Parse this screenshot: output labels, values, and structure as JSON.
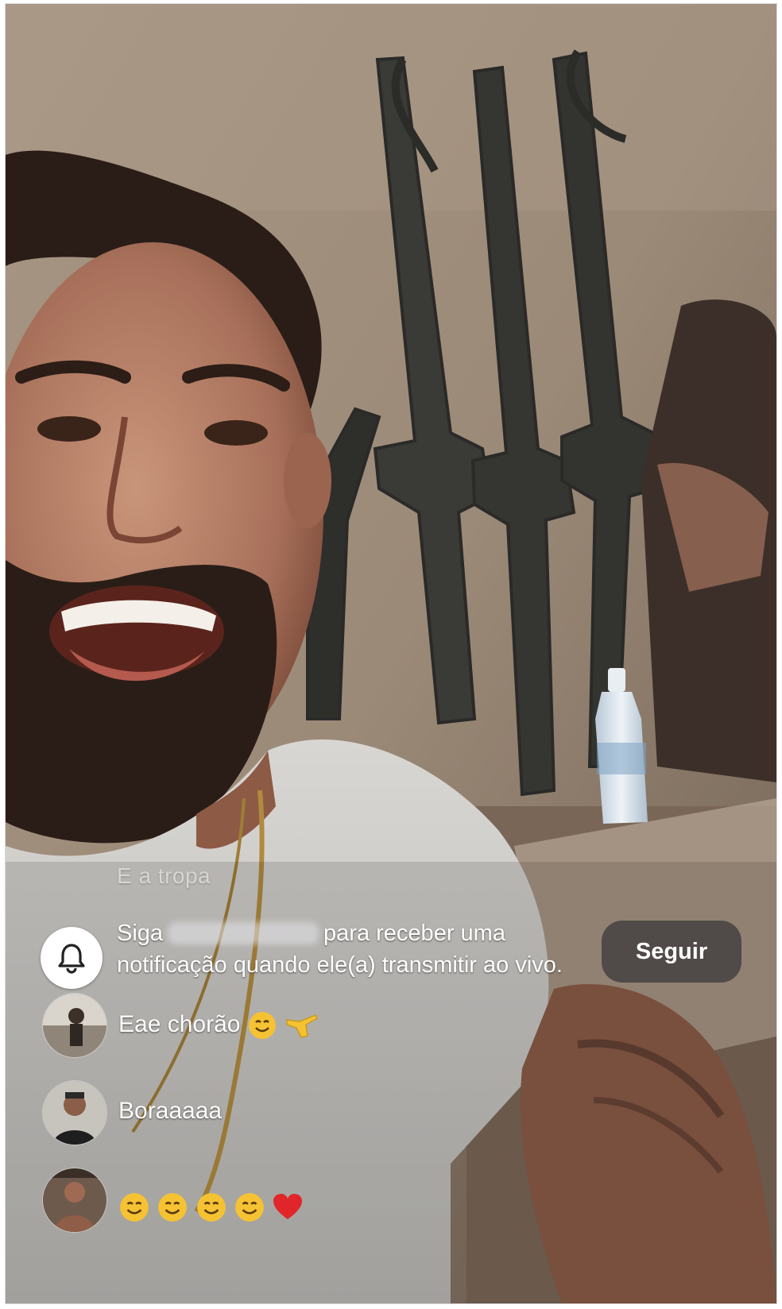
{
  "live": {
    "faded_comment": "E a tropa",
    "follow_banner": {
      "prefix": "Siga",
      "message": "para receber uma notificação quando ele(a) transmitir ao vivo.",
      "icon": "bell-icon",
      "button_label": "Seguir"
    },
    "comments": [
      {
        "avatar": "user-avatar",
        "text": "Eae chorão",
        "emojis": [
          "smiling-face-emoji",
          "pinched-hand-emoji"
        ]
      },
      {
        "avatar": "user-avatar",
        "text": "Boraaaaa",
        "emojis": []
      },
      {
        "avatar": "user-avatar",
        "text": "",
        "emojis": [
          "smiling-face-emoji",
          "smiling-face-emoji",
          "smiling-face-emoji",
          "smiling-face-emoji",
          "red-heart-emoji"
        ]
      }
    ]
  },
  "colors": {
    "overlay_text": "#ffffff",
    "follow_button_bg": "#28282e",
    "heart": "#e0262b",
    "emoji_face": "#f5c233"
  }
}
